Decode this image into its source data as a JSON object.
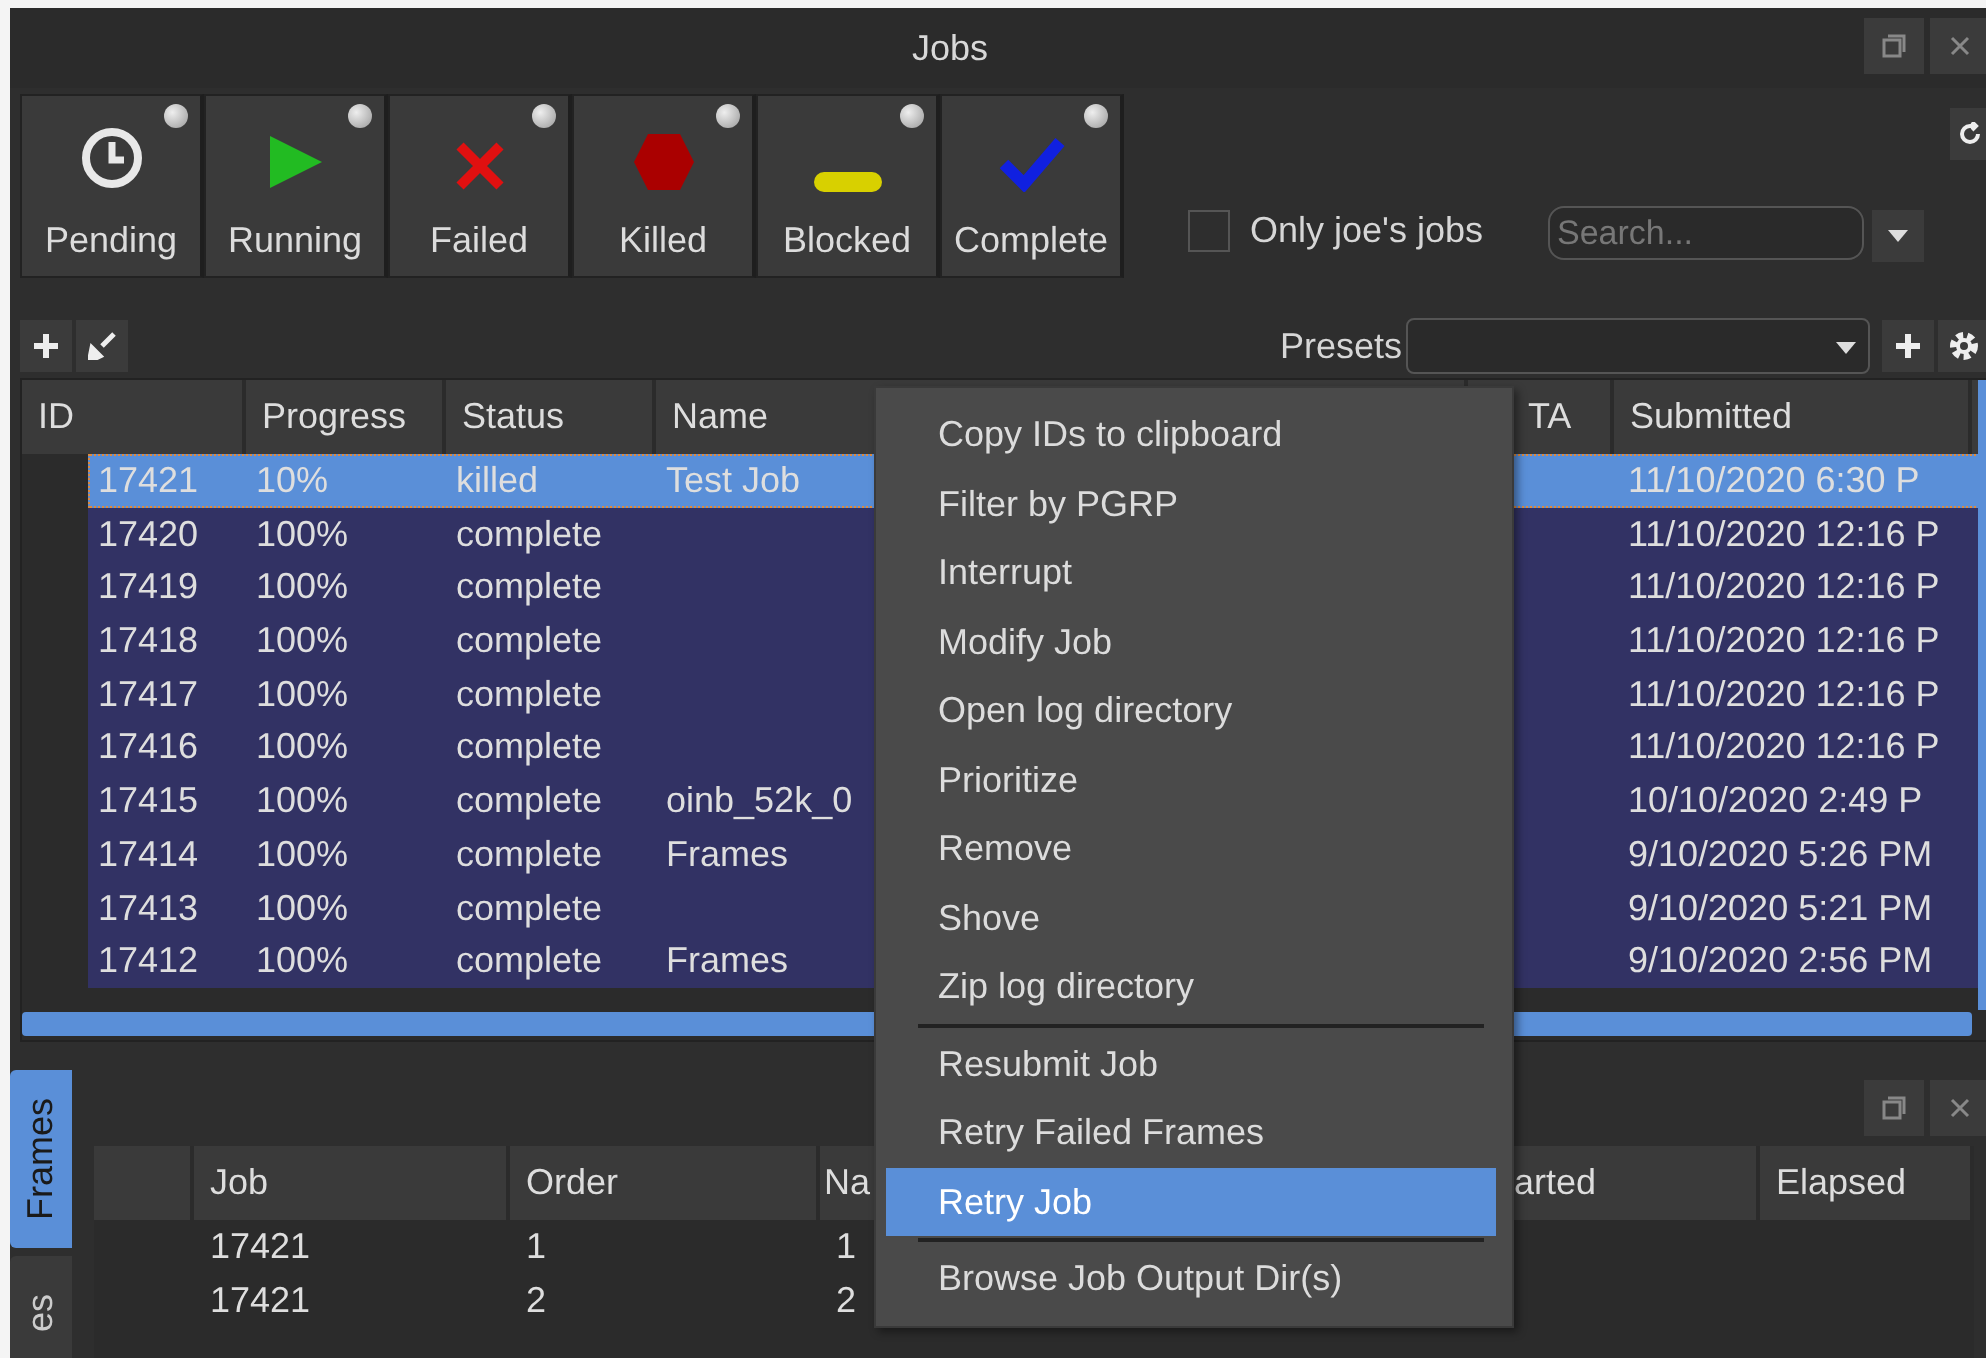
{
  "window": {
    "title": "Jobs"
  },
  "filters": [
    {
      "label": "Pending",
      "kind": "pending"
    },
    {
      "label": "Running",
      "kind": "running"
    },
    {
      "label": "Failed",
      "kind": "failed"
    },
    {
      "label": "Killed",
      "kind": "killed"
    },
    {
      "label": "Blocked",
      "kind": "blocked"
    },
    {
      "label": "Complete",
      "kind": "complete"
    }
  ],
  "only_mine": {
    "label": "Only joe's jobs",
    "checked": false
  },
  "search": {
    "placeholder": "Search..."
  },
  "presets": {
    "label": "Presets"
  },
  "jobs_table": {
    "columns": [
      "ID",
      "Progress",
      "Status",
      "Name",
      "TA",
      "Submitted"
    ],
    "rows": [
      {
        "id": "17421",
        "progress": "10%",
        "status": "killed",
        "name": "Test Job",
        "submitted": "11/10/2020 6:30 P",
        "selected": true,
        "current": true
      },
      {
        "id": "17420",
        "progress": "100%",
        "status": "complete",
        "name": "",
        "submitted": "11/10/2020 12:16 P",
        "selected": true,
        "current": false
      },
      {
        "id": "17419",
        "progress": "100%",
        "status": "complete",
        "name": "",
        "submitted": "11/10/2020 12:16 P",
        "selected": true,
        "current": false
      },
      {
        "id": "17418",
        "progress": "100%",
        "status": "complete",
        "name": "",
        "submitted": "11/10/2020 12:16 P",
        "selected": true,
        "current": false
      },
      {
        "id": "17417",
        "progress": "100%",
        "status": "complete",
        "name": "",
        "submitted": "11/10/2020 12:16 P",
        "selected": true,
        "current": false
      },
      {
        "id": "17416",
        "progress": "100%",
        "status": "complete",
        "name": "",
        "submitted": "11/10/2020 12:16 P",
        "selected": true,
        "current": false
      },
      {
        "id": "17415",
        "progress": "100%",
        "status": "complete",
        "name": "oinb_52k_0",
        "submitted": "10/10/2020 2:49 P",
        "selected": true,
        "current": false
      },
      {
        "id": "17414",
        "progress": "100%",
        "status": "complete",
        "name": "Frames",
        "submitted": "9/10/2020 5:26 PM",
        "selected": true,
        "current": false
      },
      {
        "id": "17413",
        "progress": "100%",
        "status": "complete",
        "name": "",
        "submitted": "9/10/2020 5:21 PM",
        "selected": true,
        "current": false
      },
      {
        "id": "17412",
        "progress": "100%",
        "status": "complete",
        "name": "Frames",
        "submitted": "9/10/2020 2:56 PM",
        "selected": true,
        "current": false
      }
    ]
  },
  "side_tabs": [
    {
      "label": "Frames",
      "selected": true
    },
    {
      "label": "es",
      "selected": false
    }
  ],
  "frames_table": {
    "columns": [
      "Job",
      "Order",
      "Na",
      "arted",
      "Elapsed"
    ],
    "rows": [
      {
        "job": "17421",
        "order": "1",
        "name": "1"
      },
      {
        "job": "17421",
        "order": "2",
        "name": "2"
      }
    ]
  },
  "context_menu": [
    {
      "kind": "item",
      "label": "Copy IDs to clipboard",
      "selected": false
    },
    {
      "kind": "item",
      "label": "Filter by PGRP",
      "selected": false
    },
    {
      "kind": "item",
      "label": "Interrupt",
      "selected": false
    },
    {
      "kind": "item",
      "label": "Modify Job",
      "selected": false
    },
    {
      "kind": "item",
      "label": "Open log directory",
      "selected": false
    },
    {
      "kind": "item",
      "label": "Prioritize",
      "selected": false
    },
    {
      "kind": "item",
      "label": "Remove",
      "selected": false
    },
    {
      "kind": "item",
      "label": "Shove",
      "selected": false
    },
    {
      "kind": "item",
      "label": "Zip log directory",
      "selected": false
    },
    {
      "kind": "separator"
    },
    {
      "kind": "item",
      "label": "Resubmit Job",
      "selected": false
    },
    {
      "kind": "item",
      "label": "Retry Failed Frames",
      "selected": false
    },
    {
      "kind": "item",
      "label": "Retry Job",
      "selected": true
    },
    {
      "kind": "separator"
    },
    {
      "kind": "item",
      "label": "Browse Job Output Dir(s)",
      "selected": false
    }
  ]
}
